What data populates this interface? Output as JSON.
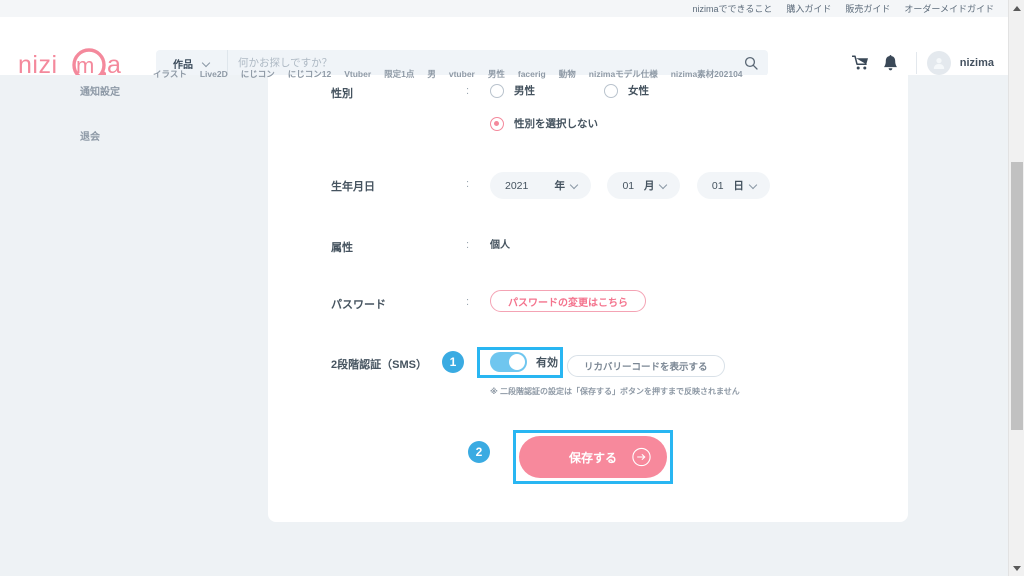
{
  "topbar": {
    "links": [
      "nizimaでできること",
      "購入ガイド",
      "販売ガイド",
      "オーダーメイドガイド"
    ]
  },
  "header": {
    "logo_text": "nizima",
    "search": {
      "category": "作品",
      "placeholder": "何かお探しですか？",
      "value": "",
      "icon": "search-icon"
    },
    "cart_icon": "cart-icon",
    "bell_icon": "bell-icon",
    "user_name": "nizima",
    "avatar_icon": "user-avatar-icon"
  },
  "tags": [
    "イラスト",
    "Live2D",
    "にじコン",
    "にじコン12",
    "Vtuber",
    "限定1点",
    "男",
    "vtuber",
    "男性",
    "facerig",
    "動物",
    "nizimaモデル仕様",
    "nizima素材202104"
  ],
  "sidebar": {
    "items": [
      {
        "label": "通知設定"
      },
      {
        "label": "退会"
      }
    ]
  },
  "form": {
    "gender": {
      "label": "性別",
      "colon": ":",
      "options": [
        {
          "label": "男性",
          "selected": false
        },
        {
          "label": "女性",
          "selected": false
        },
        {
          "label": "性別を選択しない",
          "selected": true
        }
      ]
    },
    "birthday": {
      "label": "生年月日",
      "colon": ":",
      "year": {
        "value": "2021",
        "unit": "年"
      },
      "month": {
        "value": "01",
        "unit": "月"
      },
      "day": {
        "value": "01",
        "unit": "日"
      }
    },
    "attribute": {
      "label": "属性",
      "colon": ":",
      "value": "個人"
    },
    "password": {
      "label": "パスワード",
      "colon": ":",
      "button_label": "パスワードの変更はこちら"
    },
    "two_factor": {
      "label": "2段階認証（SMS）",
      "step_badge": "1",
      "toggle_state_label": "有効",
      "toggle_on": true,
      "recovery_button_label": "リカバリーコードを表示する",
      "note": "※ 二段階認証の設定は「保存する」ボタンを押すまで反映されません"
    },
    "save": {
      "step_badge": "2",
      "label": "保存する",
      "arrow_icon": "arrow-right-circle-icon"
    }
  },
  "colors": {
    "brand_pink": "#f4899c",
    "highlight_blue": "#29b6f2",
    "badge_blue": "#3aabe2",
    "page_bg": "#eef2f5",
    "card_bg": "#ffffff",
    "text": "#45535f"
  },
  "scrollbar": {
    "thumb_top_pct": 28,
    "thumb_height_pct": 47
  }
}
